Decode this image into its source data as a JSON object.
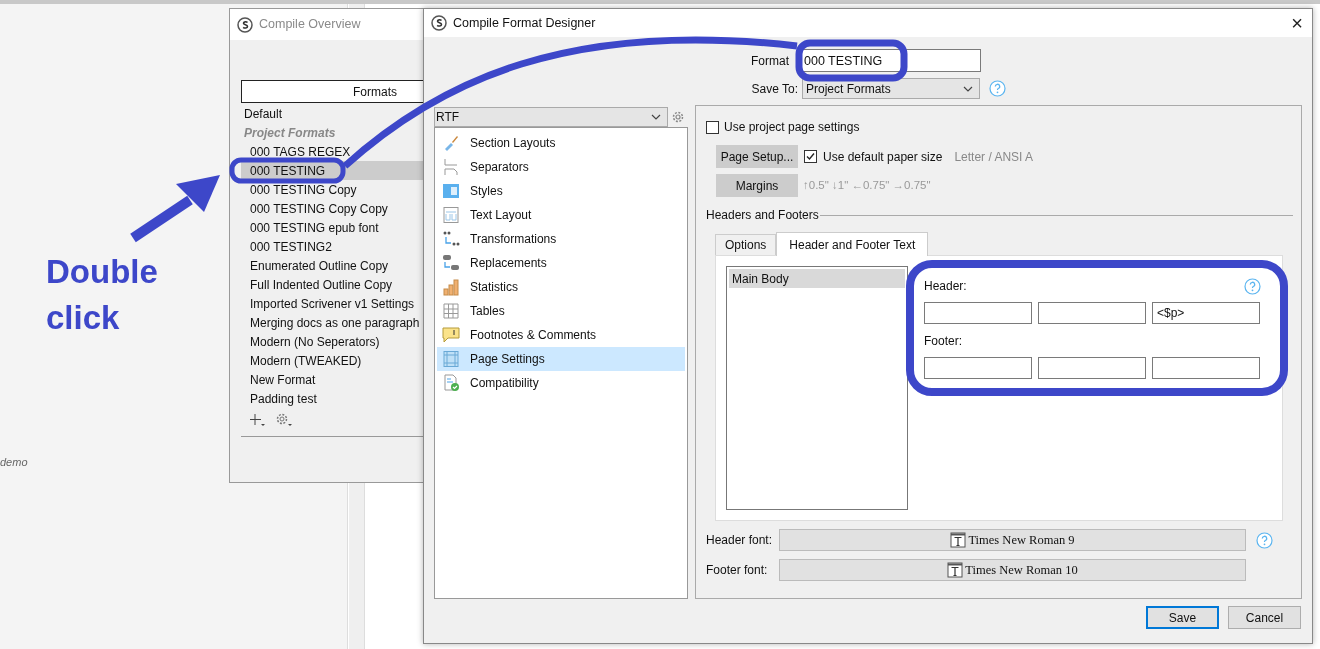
{
  "background": {
    "label": "demo"
  },
  "compile_overview": {
    "title": "Compile Overview",
    "column_header": "Formats",
    "items": [
      {
        "label": "Default",
        "kind": "plain",
        "selected": false
      },
      {
        "label": "Project Formats",
        "kind": "section",
        "selected": false
      },
      {
        "label": "000 TAGS REGEX",
        "kind": "nested",
        "selected": false
      },
      {
        "label": "000 TESTING",
        "kind": "nested",
        "selected": true
      },
      {
        "label": "000 TESTING Copy",
        "kind": "nested",
        "selected": false
      },
      {
        "label": "000 TESTING Copy Copy",
        "kind": "nested",
        "selected": false
      },
      {
        "label": "000 TESTING epub font",
        "kind": "nested",
        "selected": false
      },
      {
        "label": "000 TESTING2",
        "kind": "nested",
        "selected": false
      },
      {
        "label": "Enumerated Outline Copy",
        "kind": "nested",
        "selected": false
      },
      {
        "label": "Full Indented Outline Copy",
        "kind": "nested",
        "selected": false
      },
      {
        "label": "Imported Scrivener v1 Settings",
        "kind": "nested",
        "selected": false
      },
      {
        "label": "Merging docs as one paragraph",
        "kind": "nested",
        "selected": false
      },
      {
        "label": "Modern (No Seperators)",
        "kind": "nested",
        "selected": false
      },
      {
        "label": "Modern (TWEAKED)",
        "kind": "nested",
        "selected": false
      },
      {
        "label": "New Format",
        "kind": "nested",
        "selected": false
      },
      {
        "label": "Padding test",
        "kind": "nested",
        "selected": false
      }
    ]
  },
  "designer": {
    "title": "Compile Format Designer",
    "close": "×",
    "format_name": {
      "label": "Format",
      "value": "000 TESTING"
    },
    "save_to": {
      "label": "Save To:",
      "value": "Project Formats"
    },
    "output_type": "RTF",
    "sections": [
      {
        "label": "Section Layouts",
        "selected": false
      },
      {
        "label": "Separators",
        "selected": false
      },
      {
        "label": "Styles",
        "selected": false
      },
      {
        "label": "Text Layout",
        "selected": false
      },
      {
        "label": "Transformations",
        "selected": false
      },
      {
        "label": "Replacements",
        "selected": false
      },
      {
        "label": "Statistics",
        "selected": false
      },
      {
        "label": "Tables",
        "selected": false
      },
      {
        "label": "Footnotes & Comments",
        "selected": false
      },
      {
        "label": "Page Settings",
        "selected": true
      },
      {
        "label": "Compatibility",
        "selected": false
      }
    ],
    "use_project_page_settings": {
      "label": "Use project page settings",
      "checked": false
    },
    "page_setup_button": "Page Setup...",
    "use_default_paper_size": {
      "label": "Use default paper size",
      "checked": true
    },
    "paper_size": "Letter / ANSI A",
    "margins_button": "Margins",
    "margins": "↑0.5\" ↓1\" ←0.75\" →0.75\"",
    "group_title": "Headers and Footers",
    "tabs": [
      {
        "label": "Options",
        "selected": false
      },
      {
        "label": "Header and Footer Text",
        "selected": true
      }
    ],
    "layouts": [
      {
        "label": "Main Body",
        "selected": true
      }
    ],
    "header": {
      "label": "Header:",
      "fields": [
        {
          "kind": "text"
        },
        {
          "kind": "text"
        },
        {
          "kind": "text",
          "value": "<$p>"
        }
      ]
    },
    "footer": {
      "label": "Footer:",
      "fields": [
        {
          "kind": "text"
        },
        {
          "kind": "text"
        },
        {
          "kind": "text"
        }
      ]
    },
    "header_font": {
      "label": "Header font:",
      "value": "Times New Roman 9"
    },
    "footer_font": {
      "label": "Footer font:",
      "value": "Times New Roman 10"
    },
    "buttons": [
      {
        "label": "Save",
        "kind": "default"
      },
      {
        "label": "Cancel",
        "kind": "normal"
      }
    ]
  },
  "annotation": {
    "text": "Double click"
  }
}
